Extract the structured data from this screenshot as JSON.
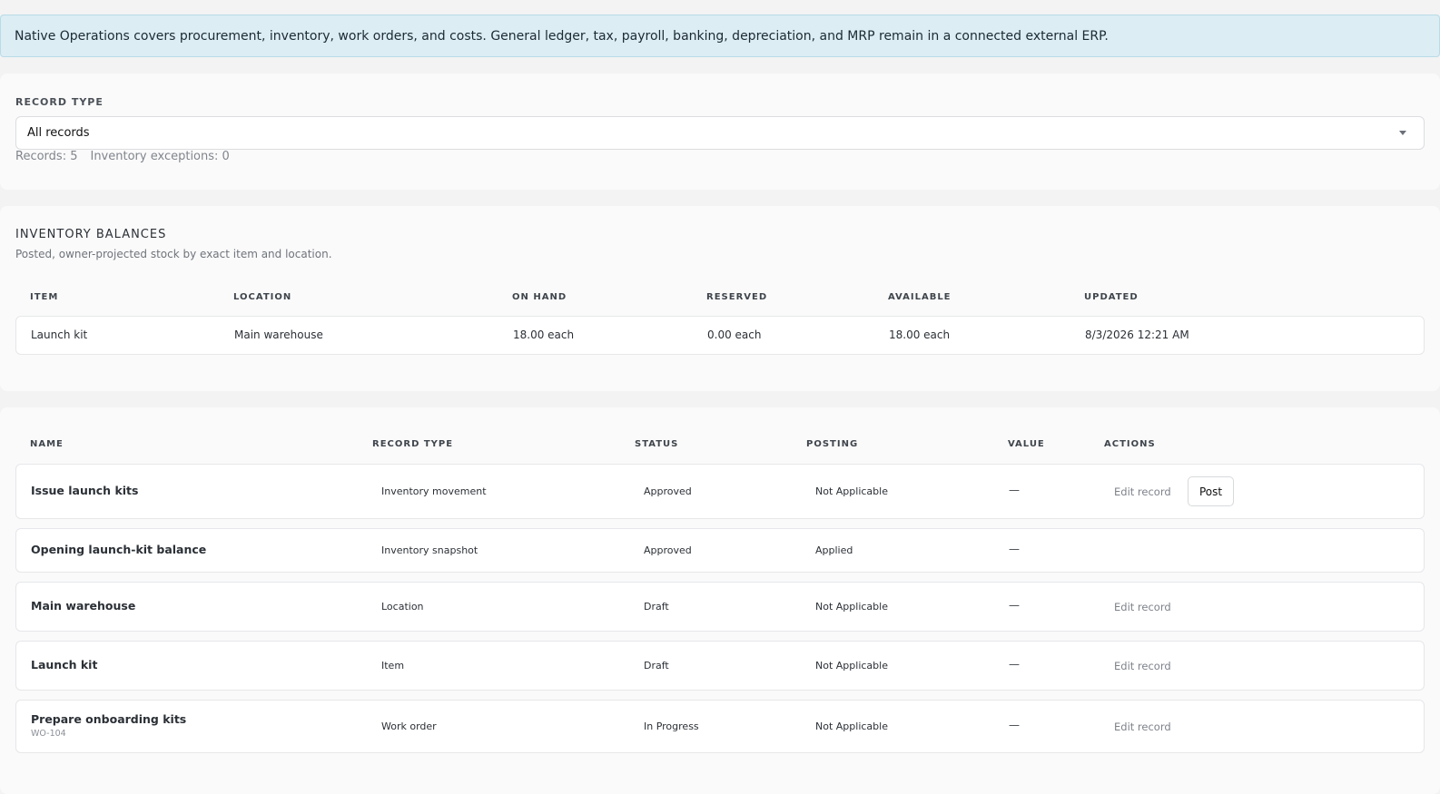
{
  "banner": {
    "text": "Native Operations covers procurement, inventory, work orders, and costs. General ledger, tax, payroll, banking, depreciation, and MRP remain in a connected external ERP."
  },
  "filter": {
    "label": "RECORD TYPE",
    "selected": "All records",
    "records_count": "Records: 5",
    "exceptions_count": "Inventory exceptions: 0"
  },
  "balances": {
    "title": "INVENTORY BALANCES",
    "subtitle": "Posted, owner-projected stock by exact item and location.",
    "headers": [
      "ITEM",
      "LOCATION",
      "ON HAND",
      "RESERVED",
      "AVAILABLE",
      "UPDATED"
    ],
    "rows": [
      {
        "item": "Launch kit",
        "location": "Main warehouse",
        "on_hand": "18.00 each",
        "reserved": "0.00 each",
        "available": "18.00 each",
        "updated": "8/3/2026 12:21 AM"
      }
    ]
  },
  "records": {
    "headers": [
      "NAME",
      "RECORD TYPE",
      "STATUS",
      "POSTING",
      "VALUE",
      "ACTIONS"
    ],
    "edit_label": "Edit record",
    "post_label": "Post",
    "rows": [
      {
        "name": "Issue launch kits",
        "sub": "",
        "type": "Inventory movement",
        "status": "Approved",
        "posting": "Not Applicable",
        "value": "—"
      },
      {
        "name": "Opening launch-kit balance",
        "sub": "",
        "type": "Inventory snapshot",
        "status": "Approved",
        "posting": "Applied",
        "value": "—"
      },
      {
        "name": "Main warehouse",
        "sub": "",
        "type": "Location",
        "status": "Draft",
        "posting": "Not Applicable",
        "value": "—"
      },
      {
        "name": "Launch kit",
        "sub": "",
        "type": "Item",
        "status": "Draft",
        "posting": "Not Applicable",
        "value": "—"
      },
      {
        "name": "Prepare onboarding kits",
        "sub": "WO-104",
        "type": "Work order",
        "status": "In Progress",
        "posting": "Not Applicable",
        "value": "—"
      }
    ]
  }
}
